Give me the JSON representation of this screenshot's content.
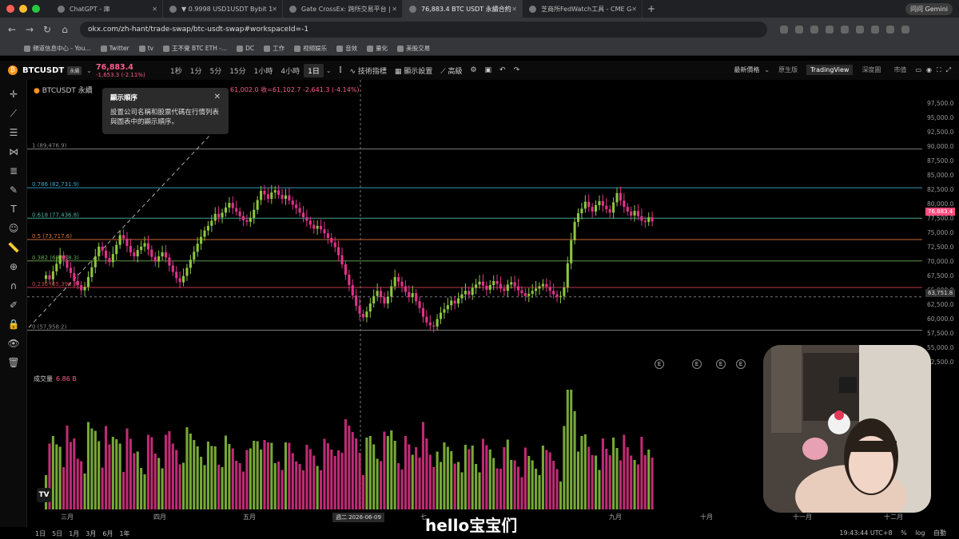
{
  "browser": {
    "tabs": [
      {
        "label": "ChatGPT - 庫",
        "active": false
      },
      {
        "label": "▼ 0.9998 USD1USDT Bybit 1",
        "active": false
      },
      {
        "label": "Gate CrossEx: 跨所交易平台 |",
        "active": false
      },
      {
        "label": "76,883.4 BTC USDT 永續合約",
        "active": true
      },
      {
        "label": "芝商所FedWatch工具 - CME G",
        "active": false
      }
    ],
    "profile": "问问 Gemini",
    "url": "okx.com/zh-hant/trade-swap/btc-usdt-swap#workspaceId=-1",
    "bookmarks": [
      "頻道信息中心 - You...",
      "Twitter",
      "tv",
      "王不覺 BTC ETH -...",
      "DC",
      "工作",
      "视频娱乐",
      "音效",
      "量化",
      "美股交易"
    ]
  },
  "toolbar": {
    "symbol": "BTCUSDT",
    "badge": "永續",
    "price": "76,883.4",
    "change": "-1,653.3 (-2.11%)",
    "timeframes": [
      "1秒",
      "1分",
      "5分",
      "15分",
      "1小時",
      "4小時",
      "1日"
    ],
    "selected_tf": "1日",
    "items": [
      "技術指標",
      "顯示設置",
      "高級"
    ],
    "latest_price": "最新價格",
    "views": [
      "原生版",
      "TradingView",
      "深度圖",
      "市值"
    ],
    "selected_view": "TradingView"
  },
  "legend": {
    "title": "BTCUSDT 永續",
    "ohlc": "61,002.0  收=61,102.7  -2,641.3 (-4.14%)"
  },
  "tooltip": {
    "title": "顯示順序",
    "body": "設置公司名稱和股票代碼在行情列表與圖表中的顯示順序。"
  },
  "volume": {
    "label": "成交量",
    "value": "6.86 B"
  },
  "caption": "hello宝宝们",
  "bottom": {
    "ranges": [
      "1日",
      "5日",
      "1月",
      "3月",
      "6月",
      "1年"
    ],
    "time": "19:43:44 UTC+8",
    "options": [
      "%",
      "log",
      "自動"
    ],
    "date_chip": "週二 2026-06-09"
  },
  "colors": {
    "up": "#8cc63f",
    "down": "#e0338a",
    "price_chip": "#ff4d7d"
  },
  "chart_data": {
    "type": "candlestick",
    "yaxis_ticks": [
      "97,500.0",
      "95,000.0",
      "92,500.0",
      "90,000.0",
      "87,500.0",
      "85,000.0",
      "82,500.0",
      "80,000.0",
      "77,500.0",
      "75,000.0",
      "72,500.0",
      "70,000.0",
      "67,500.0",
      "65,000.0",
      "62,500.0",
      "60,000.0",
      "57,500.0",
      "55,000.0",
      "52,500.0"
    ],
    "ylim": [
      51500,
      99000
    ],
    "xaxis_labels": [
      "三月",
      "四月",
      "五月",
      "七",
      "九月",
      "十月",
      "十一月",
      "十二月"
    ],
    "last_price": "76,883.4",
    "crosshair_price": "63,751.8",
    "fib_levels": [
      {
        "label": "1 (89,476.9)",
        "value": 89476.9,
        "color": "#888888"
      },
      {
        "label": "0.786 (82,731.9)",
        "value": 82731.9,
        "color": "#3aa9c8"
      },
      {
        "label": "0.618 (77,436.8)",
        "value": 77436.8,
        "color": "#4cb3a0"
      },
      {
        "label": "0.5 (73,717.6)",
        "value": 73717.6,
        "color": "#e0733a"
      },
      {
        "label": "0.382 (69,998.3)",
        "value": 69998.3,
        "color": "#6aa84f"
      },
      {
        "label": "0.236 (65,396.8)",
        "value": 65396.8,
        "color": "#d04050"
      },
      {
        "label": "0 (57,958.2)",
        "value": 57958.2,
        "color": "#888888"
      }
    ],
    "closes": [
      67500,
      66800,
      68200,
      69500,
      71000,
      70200,
      68800,
      67900,
      66500,
      65800,
      64900,
      65500,
      67200,
      68900,
      70800,
      72500,
      71800,
      70500,
      69800,
      71200,
      72800,
      74500,
      73900,
      72600,
      71500,
      70800,
      71900,
      72500,
      73100,
      72000,
      70700,
      69900,
      70800,
      71500,
      70600,
      69200,
      68100,
      67000,
      66300,
      67400,
      68800,
      70200,
      71600,
      73000,
      74200,
      75300,
      76100,
      77000,
      78200,
      77600,
      78400,
      79300,
      80100,
      79200,
      78600,
      77800,
      77100,
      76800,
      77500,
      78900,
      80600,
      82200,
      81600,
      80800,
      81900,
      82300,
      81500,
      80800,
      81400,
      80500,
      79800,
      79200,
      78400,
      77600,
      77000,
      76300,
      75600,
      76100,
      75500,
      74800,
      74000,
      73200,
      72400,
      71000,
      69400,
      67600,
      65800,
      64000,
      62200,
      60800,
      60200,
      61200,
      62600,
      63900,
      64800,
      63700,
      62600,
      63800,
      65600,
      67200,
      66400,
      65600,
      64600,
      63700,
      64400,
      63000,
      61800,
      60300,
      59300,
      58800,
      58600,
      59900,
      61000,
      61600,
      62300,
      63100,
      62600,
      63500,
      64200,
      64800,
      64100,
      65300,
      65900,
      66400,
      65700,
      65000,
      65800,
      66500,
      66000,
      65200,
      64800,
      65900,
      66300,
      65600,
      64900,
      64400,
      63900,
      64300,
      64800,
      65200,
      65600,
      66000,
      65500,
      64800,
      64200,
      63700,
      63900,
      65400,
      69600,
      73600,
      76800,
      78300,
      79100,
      80300,
      79400,
      78600,
      79700,
      80400,
      79600,
      79000,
      78400,
      80200,
      81800,
      80500,
      79400,
      78600,
      77900,
      78700,
      77800,
      77000,
      76800,
      77600,
      76883
    ]
  }
}
